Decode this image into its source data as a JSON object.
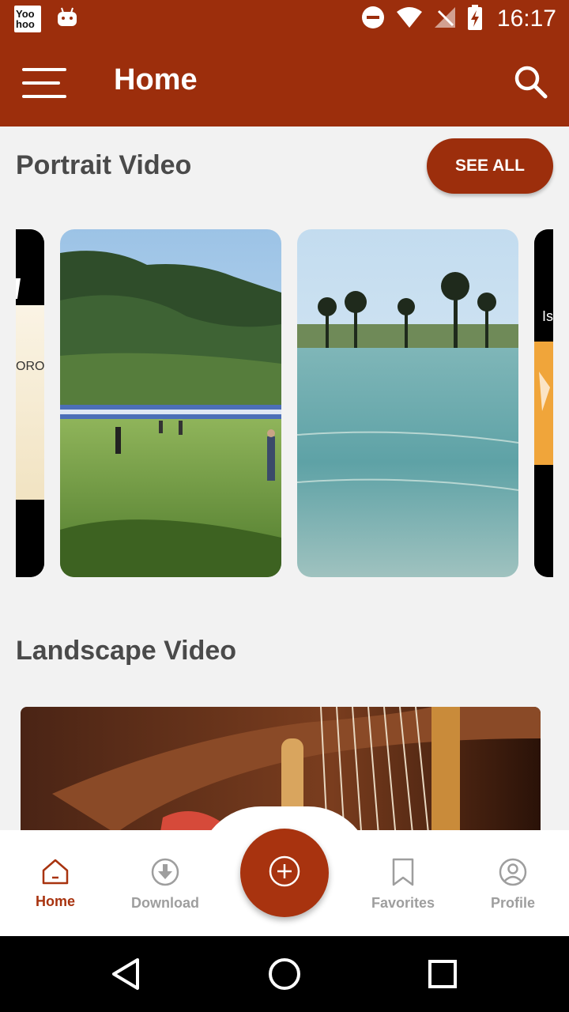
{
  "status_bar": {
    "time": "16:17",
    "app_icon_text": "Yoo hoo",
    "icons": [
      "yoohoo-app-icon",
      "android-icon",
      "dnd-icon",
      "wifi-icon",
      "no-signal-icon",
      "battery-charging-icon"
    ]
  },
  "app_bar": {
    "title": "Home"
  },
  "portrait": {
    "title": "Portrait Video",
    "see_all_label": "SEE ALL",
    "thumbs": [
      {
        "caption": "ORO"
      },
      {
        "caption": ""
      },
      {
        "caption": ""
      },
      {
        "caption": "Is"
      }
    ]
  },
  "landscape": {
    "title": "Landscape Video"
  },
  "bottom_nav": {
    "items": [
      {
        "label": "Home",
        "icon": "home-icon",
        "active": true
      },
      {
        "label": "Download",
        "icon": "download-icon",
        "active": false
      },
      {
        "label": "Favorites",
        "icon": "bookmark-icon",
        "active": false
      },
      {
        "label": "Profile",
        "icon": "profile-icon",
        "active": false
      }
    ],
    "fab_icon": "add-circle-icon"
  },
  "colors": {
    "primary": "#9c2e0c",
    "accent": "#a8330f",
    "inactive": "#9e9e9e"
  }
}
